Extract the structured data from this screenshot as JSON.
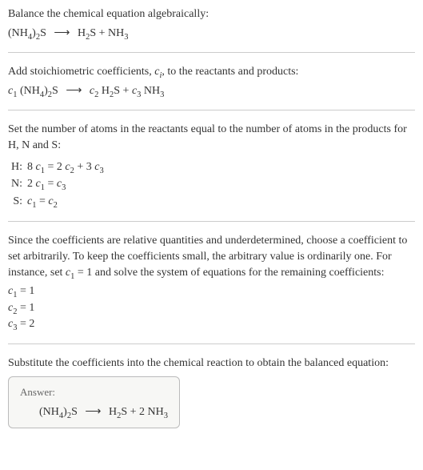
{
  "intro": {
    "line1": "Balance the chemical equation algebraically:",
    "eq_left": "(NH",
    "eq_left_sub1": "4",
    "eq_left2": ")",
    "eq_left_sub2": "2",
    "eq_left3": "S",
    "arrow": "⟶",
    "eq_right1": "H",
    "eq_right1_sub": "2",
    "eq_right2": "S + NH",
    "eq_right2_sub": "3"
  },
  "stoich": {
    "text1": "Add stoichiometric coefficients, ",
    "ci": "c",
    "ci_sub": "i",
    "text2": ", to the reactants and products:",
    "c1": "c",
    "c1_sub": "1",
    "sp1": " (NH",
    "sp1_sub1": "4",
    "sp1b": ")",
    "sp1_sub2": "2",
    "sp1c": "S",
    "arrow": "⟶",
    "c2": "c",
    "c2_sub": "2",
    "sp2": " H",
    "sp2_sub": "2",
    "sp2b": "S + ",
    "c3": "c",
    "c3_sub": "3",
    "sp3": " NH",
    "sp3_sub": "3"
  },
  "atoms": {
    "intro": "Set the number of atoms in the reactants equal to the number of atoms in the products for H, N and S:",
    "rows": [
      {
        "el": "H:",
        "lhs_coef": "8 ",
        "lhs_c": "c",
        "lhs_sub": "1",
        "eq": " = 2 ",
        "r1c": "c",
        "r1sub": "2",
        "plus": " + 3 ",
        "r2c": "c",
        "r2sub": "3"
      },
      {
        "el": "N:",
        "lhs_coef": "2 ",
        "lhs_c": "c",
        "lhs_sub": "1",
        "eq": " = ",
        "r1c": "c",
        "r1sub": "3",
        "plus": "",
        "r2c": "",
        "r2sub": ""
      },
      {
        "el": "S:",
        "lhs_coef": "",
        "lhs_c": "c",
        "lhs_sub": "1",
        "eq": " = ",
        "r1c": "c",
        "r1sub": "2",
        "plus": "",
        "r2c": "",
        "r2sub": ""
      }
    ]
  },
  "solve": {
    "text1": "Since the coefficients are relative quantities and underdetermined, choose a coefficient to set arbitrarily. To keep the coefficients small, the arbitrary value is ordinarily one. For instance, set ",
    "cvar": "c",
    "csub": "1",
    "text2": " = 1 and solve the system of equations for the remaining coefficients:",
    "results": [
      {
        "c": "c",
        "sub": "1",
        "val": " = 1"
      },
      {
        "c": "c",
        "sub": "2",
        "val": " = 1"
      },
      {
        "c": "c",
        "sub": "3",
        "val": " = 2"
      }
    ]
  },
  "final": {
    "intro": "Substitute the coefficients into the chemical reaction to obtain the balanced equation:",
    "answer_label": "Answer:",
    "l1": "(NH",
    "l1s1": "4",
    "l2": ")",
    "l2s": "2",
    "l3": "S",
    "arrow": "⟶",
    "r1": "H",
    "r1s": "2",
    "r2": "S + 2 NH",
    "r2s": "3"
  }
}
